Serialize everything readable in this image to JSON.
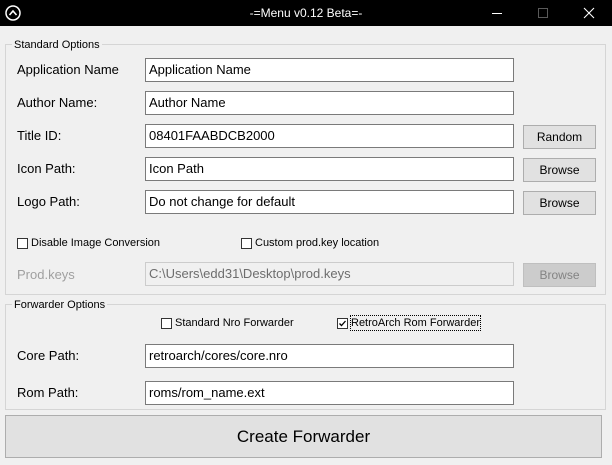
{
  "window": {
    "title": "-=Menu v0.12 Beta=-",
    "icons": {
      "app": "chevron-up-circle-icon",
      "minimize": "minimize-icon",
      "maximize": "maximize-icon",
      "close": "close-icon"
    }
  },
  "standard_options": {
    "legend": "Standard Options",
    "app_name": {
      "label": "Application Name",
      "value": "Application Name"
    },
    "author_name": {
      "label": "Author Name:",
      "value": "Author Name"
    },
    "title_id": {
      "label": "Title ID:",
      "value": "08401FAABDCB2000",
      "button": "Random"
    },
    "icon_path": {
      "label": "Icon Path:",
      "value": "Icon Path",
      "button": "Browse"
    },
    "logo_path": {
      "label": "Logo Path:",
      "value": "Do not change for default",
      "button": "Browse"
    },
    "disable_image_conversion": {
      "label": "Disable Image Conversion",
      "checked": false
    },
    "custom_prod_key": {
      "label": "Custom prod.key location",
      "checked": false
    },
    "prod_keys": {
      "label": "Prod.keys",
      "value": "C:\\Users\\edd31\\Desktop\\prod.keys",
      "button": "Browse"
    }
  },
  "forwarder_options": {
    "legend": "Forwarder Options",
    "standard_nro": {
      "label": "Standard Nro Forwarder",
      "checked": false
    },
    "retroarch_rom": {
      "label": "RetroArch Rom Forwarder",
      "checked": true
    },
    "core_path": {
      "label": "Core Path:",
      "value": "retroarch/cores/core.nro"
    },
    "rom_path": {
      "label": "Rom Path:",
      "value": "roms/rom_name.ext"
    }
  },
  "create_button": {
    "label": "Create Forwarder"
  }
}
